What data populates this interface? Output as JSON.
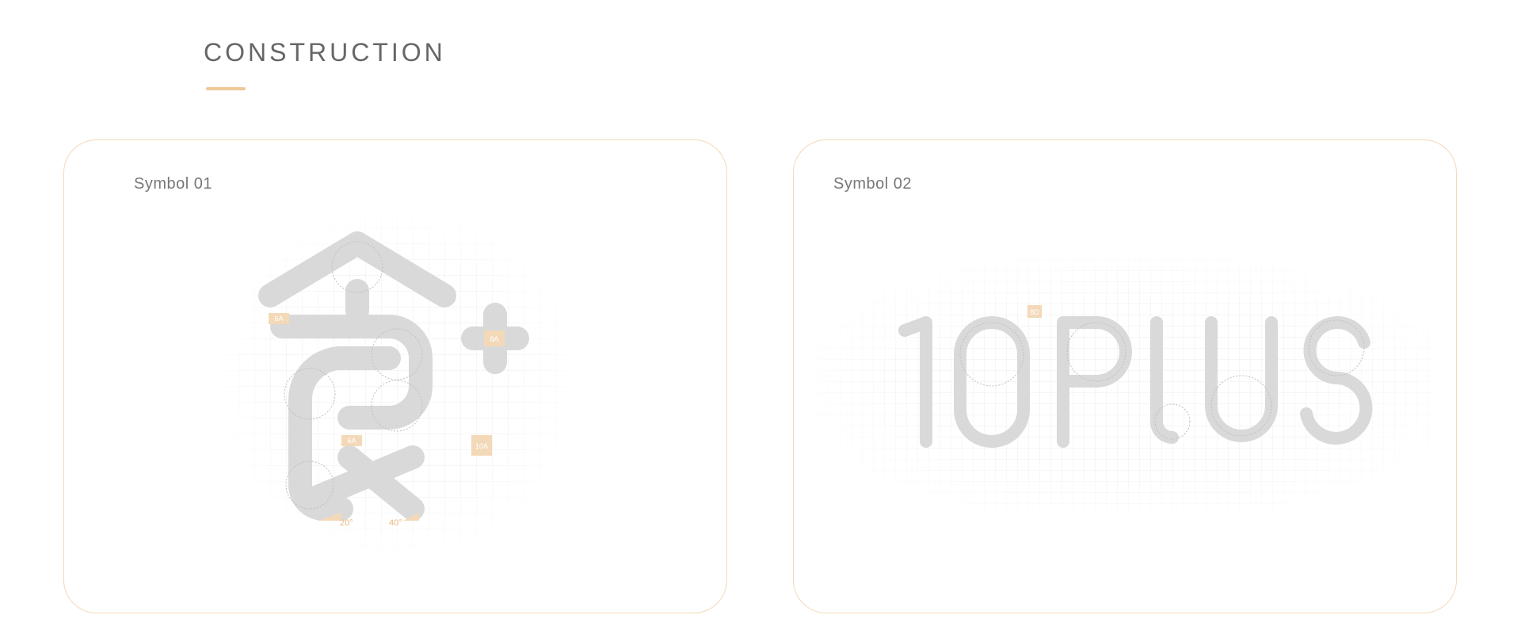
{
  "section": {
    "title": "CONSTRUCTION"
  },
  "cards": [
    {
      "label": "Symbol 01",
      "tags": [
        "6A",
        "8A",
        "6A",
        "10A"
      ],
      "angles": [
        "20°",
        "40°"
      ]
    },
    {
      "label": "Symbol 02",
      "tags": [
        "8D"
      ]
    }
  ],
  "colors": {
    "accent": "#f0c896",
    "card_border": "#f3d9b8",
    "shape_fill": "#d9d9d9",
    "grid_line": "#ececec"
  }
}
